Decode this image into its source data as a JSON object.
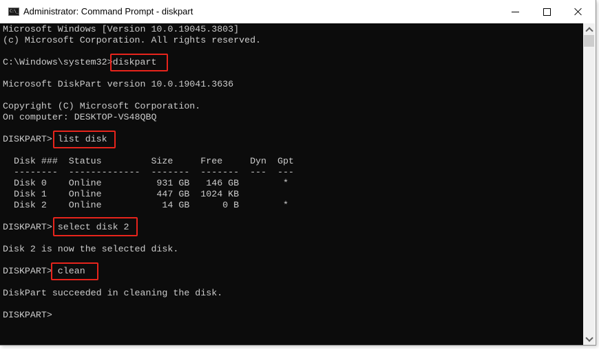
{
  "window": {
    "title": "Administrator: Command Prompt - diskpart",
    "icon": "cmd-icon",
    "icon_text": "C:\\_",
    "controls": [
      "minimize",
      "maximize",
      "close"
    ]
  },
  "console": {
    "lines": [
      "Microsoft Windows [Version 10.0.19045.3803]",
      "(c) Microsoft Corporation. All rights reserved.",
      "",
      "C:\\Windows\\system32>diskpart",
      "",
      "Microsoft DiskPart version 10.0.19041.3636",
      "",
      "Copyright (C) Microsoft Corporation.",
      "On computer: DESKTOP-VS48QBQ",
      "",
      "DISKPART> list disk",
      "",
      "  Disk ###  Status         Size     Free     Dyn  Gpt",
      "  --------  -------------  -------  -------  ---  ---",
      "  Disk 0    Online          931 GB   146 GB        *",
      "  Disk 1    Online          447 GB  1024 KB",
      "  Disk 2    Online           14 GB      0 B        *",
      "",
      "DISKPART> select disk 2",
      "",
      "Disk 2 is now the selected disk.",
      "",
      "DISKPART> clean",
      "",
      "DiskPart succeeded in cleaning the disk.",
      "",
      "DISKPART> "
    ],
    "disk_table": {
      "headers": [
        "Disk ###",
        "Status",
        "Size",
        "Free",
        "Dyn",
        "Gpt"
      ],
      "rows": [
        [
          "Disk 0",
          "Online",
          "931 GB",
          "146 GB",
          "",
          "*"
        ],
        [
          "Disk 1",
          "Online",
          "447 GB",
          "1024 KB",
          "",
          ""
        ],
        [
          "Disk 2",
          "Online",
          "14 GB",
          "0 B",
          "",
          "*"
        ]
      ]
    },
    "highlighted_commands": [
      "diskpart",
      "list disk",
      "select disk 2",
      "clean"
    ],
    "highlight_color": "#e8241c",
    "text_color": "#cccccc",
    "background_color": "#0c0c0c"
  }
}
